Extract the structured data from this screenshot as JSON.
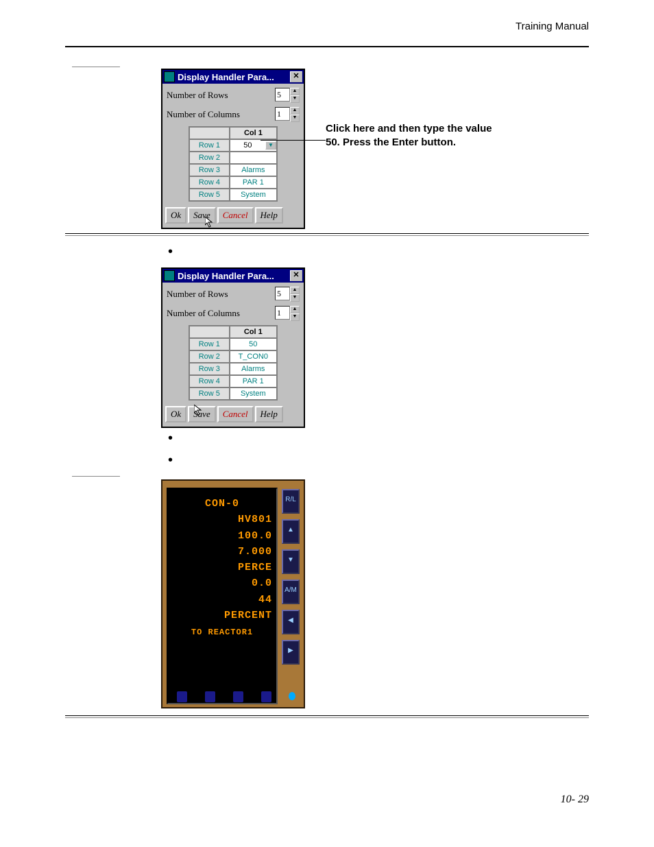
{
  "header": "Training Manual",
  "callout": "Click here and then type the value 50. Press the Enter button.",
  "dialog1": {
    "title": "Display Handler Para...",
    "rowsLabel": "Number of Rows",
    "rowsValue": "5",
    "colsLabel": "Number of Columns",
    "colsValue": "1",
    "colHeader": "Col 1",
    "rows": [
      {
        "hdr": "Row 1",
        "val": "50",
        "combo": true
      },
      {
        "hdr": "Row 2",
        "val": ""
      },
      {
        "hdr": "Row 3",
        "val": "Alarms"
      },
      {
        "hdr": "Row 4",
        "val": "PAR 1"
      },
      {
        "hdr": "Row 5",
        "val": "System"
      }
    ],
    "buttons": {
      "ok": "Ok",
      "save": "Save",
      "cancel": "Cancel",
      "help": "Help"
    }
  },
  "dialog2": {
    "title": "Display Handler Para...",
    "rowsLabel": "Number of Rows",
    "rowsValue": "5",
    "colsLabel": "Number of Columns",
    "colsValue": "1",
    "colHeader": "Col 1",
    "rows": [
      {
        "hdr": "Row 1",
        "val": "50"
      },
      {
        "hdr": "Row 2",
        "val": "T_CON0"
      },
      {
        "hdr": "Row 3",
        "val": "Alarms"
      },
      {
        "hdr": "Row 4",
        "val": "PAR 1"
      },
      {
        "hdr": "Row 5",
        "val": "System"
      }
    ],
    "buttons": {
      "ok": "Ok",
      "save": "Save",
      "cancel": "Cancel",
      "help": "Help"
    }
  },
  "controller": {
    "lines": [
      "CON-0",
      "HV801",
      "100.0",
      "7.000",
      "PERCE",
      "0.0",
      "44",
      "PERCENT",
      "TO REACTOR1"
    ],
    "sideLabels": [
      "R/L",
      "▲",
      "▼",
      "A/M",
      "◀",
      "▶"
    ]
  },
  "footer": "10- 29"
}
